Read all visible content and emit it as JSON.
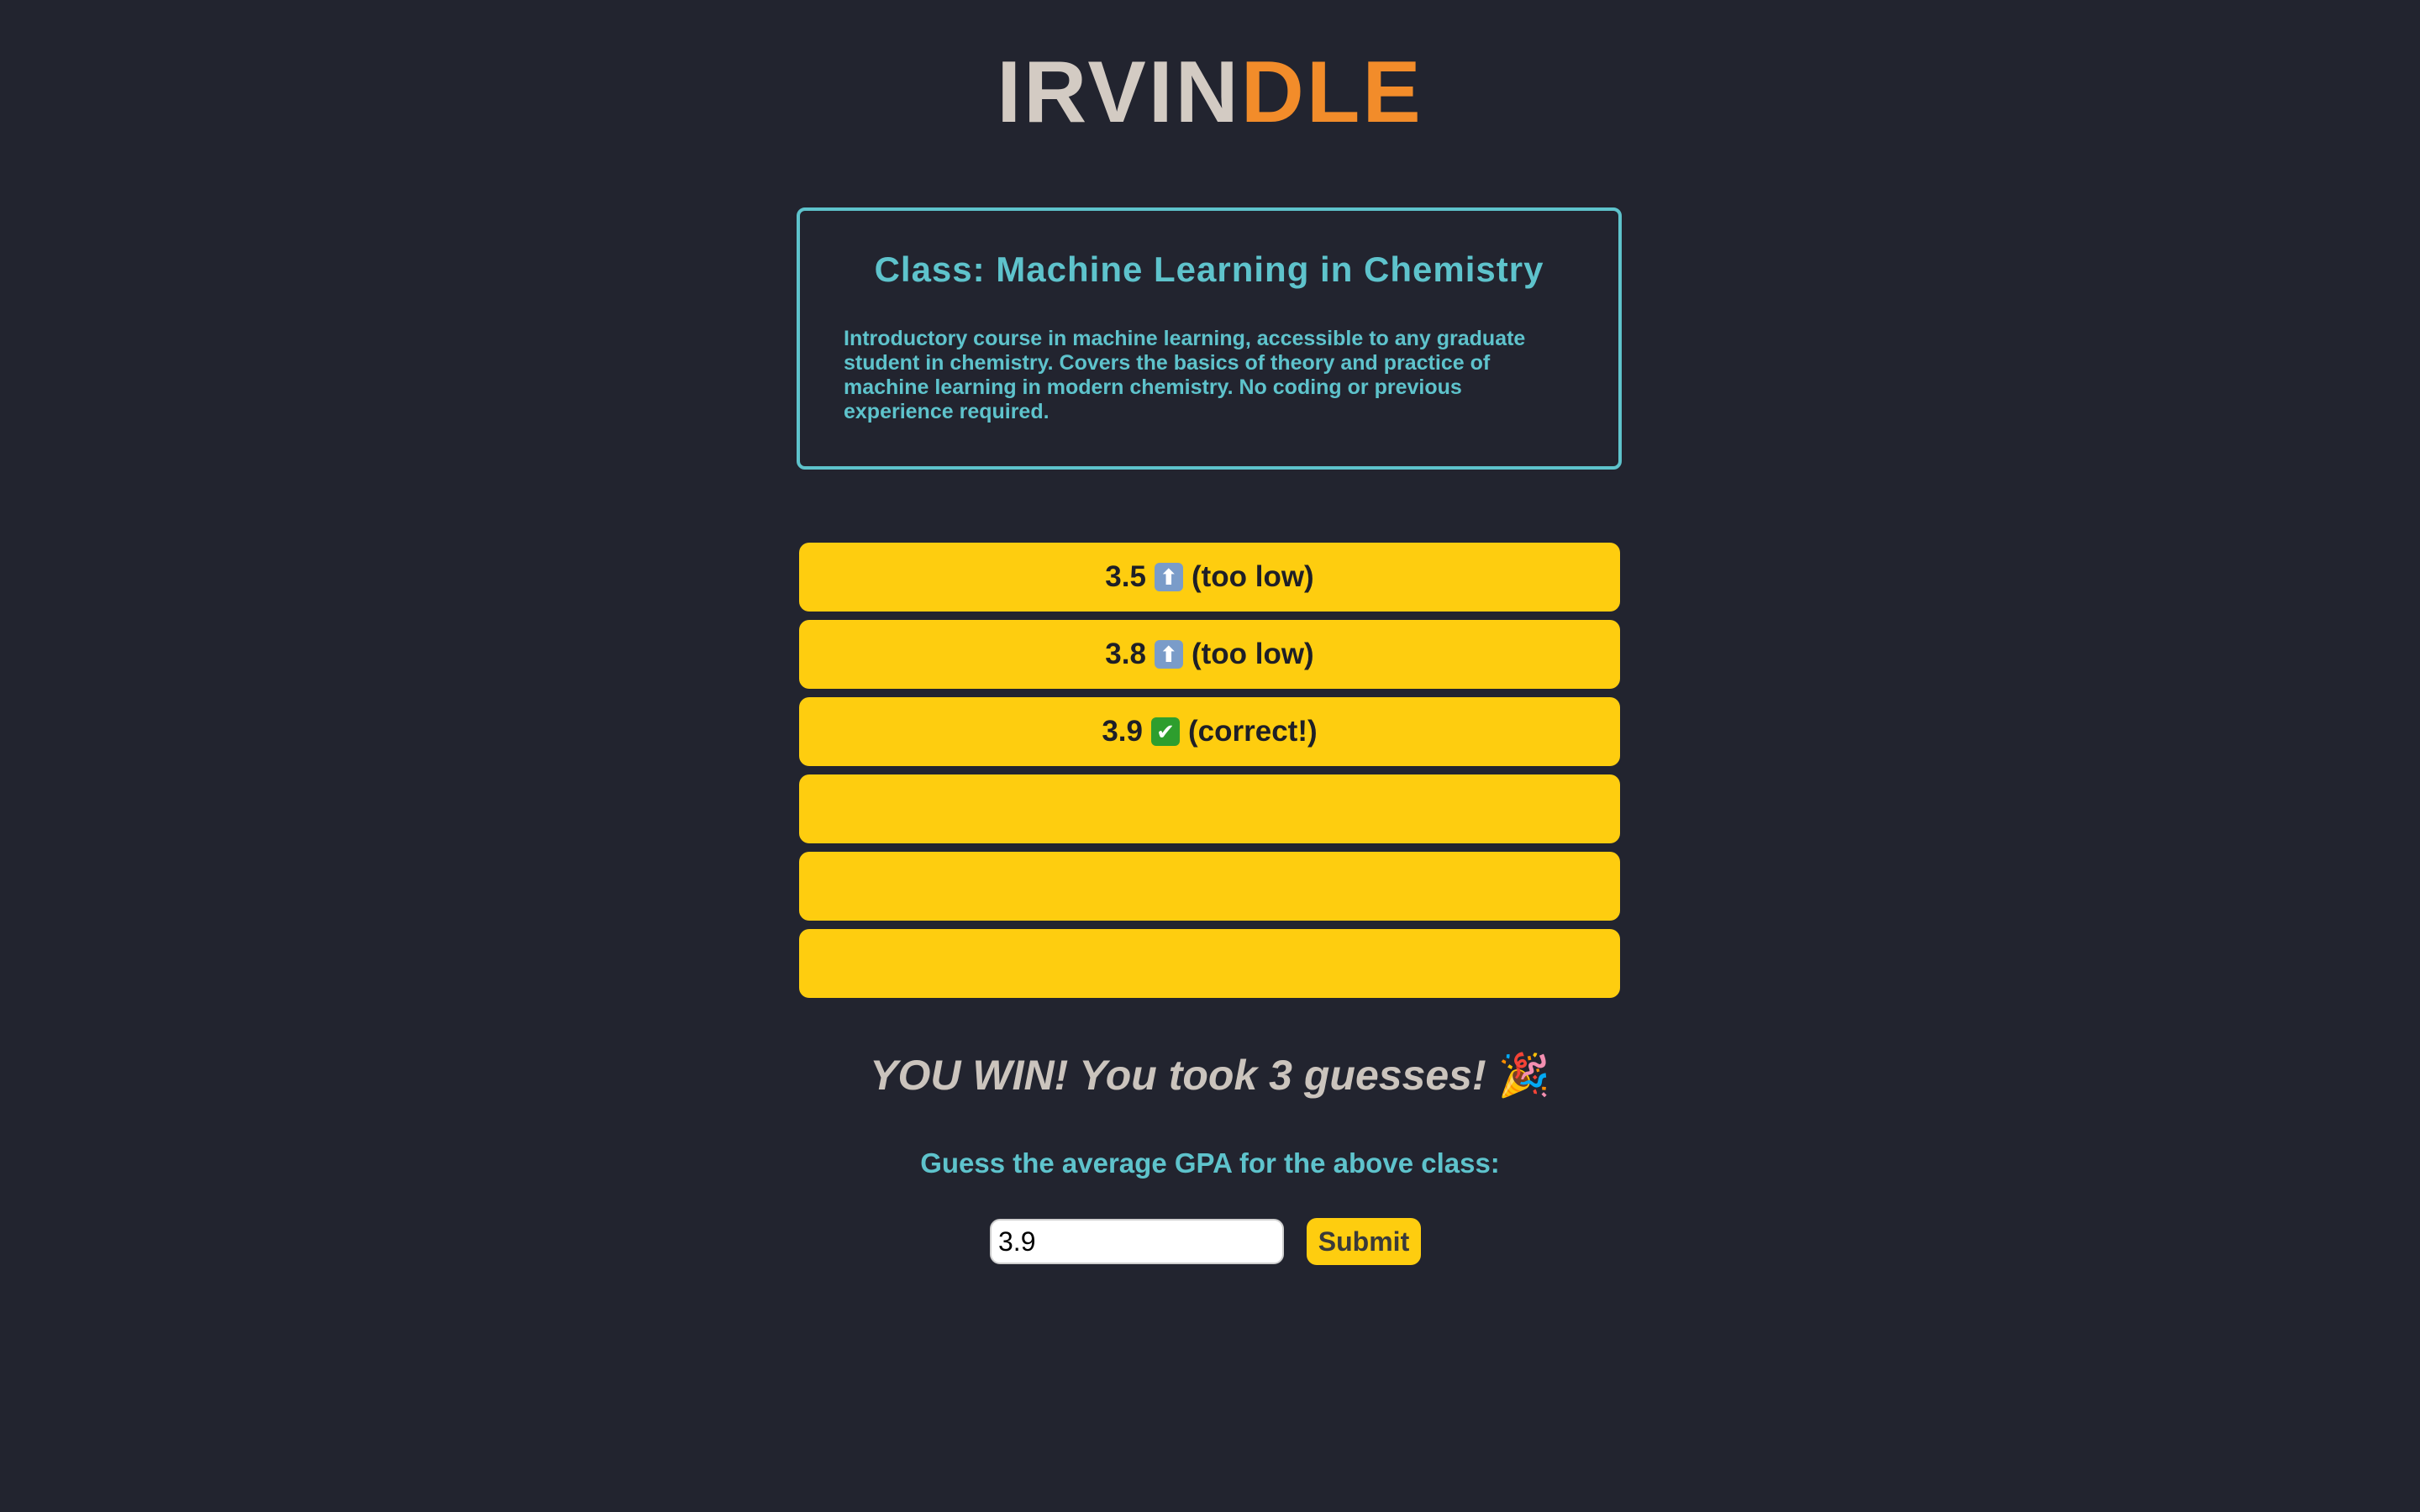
{
  "app": {
    "logo_part1": "IRVIN",
    "logo_part2": "DLE"
  },
  "class_card": {
    "title": "Class: Machine Learning in Chemistry",
    "description": "Introductory course in machine learning, accessible to any graduate student in chemistry. Covers the basics of theory and practice of machine learning in modern chemistry. No coding or previous experience required."
  },
  "guesses": [
    {
      "value": "3.5",
      "icon": "arrow-up-icon",
      "glyph": "⬆",
      "feedback": "(too low)"
    },
    {
      "value": "3.8",
      "icon": "arrow-up-icon",
      "glyph": "⬆",
      "feedback": "(too low)"
    },
    {
      "value": "3.9",
      "icon": "check-mark-icon",
      "glyph": "✔",
      "feedback": "(correct!)"
    }
  ],
  "result": {
    "message": "YOU WIN! You took 3 guesses!",
    "icon": "party-popper-icon",
    "glyph": "🎉"
  },
  "prompt": "Guess the average GPA for the above class:",
  "input": {
    "value": "3.9"
  },
  "submit_label": "Submit",
  "colors": {
    "background": "#22242f",
    "accent_teal": "#5ec3cc",
    "accent_orange": "#f28c2a",
    "guess_yellow": "#fecd0f",
    "logo_grey": "#d3cbc3"
  }
}
